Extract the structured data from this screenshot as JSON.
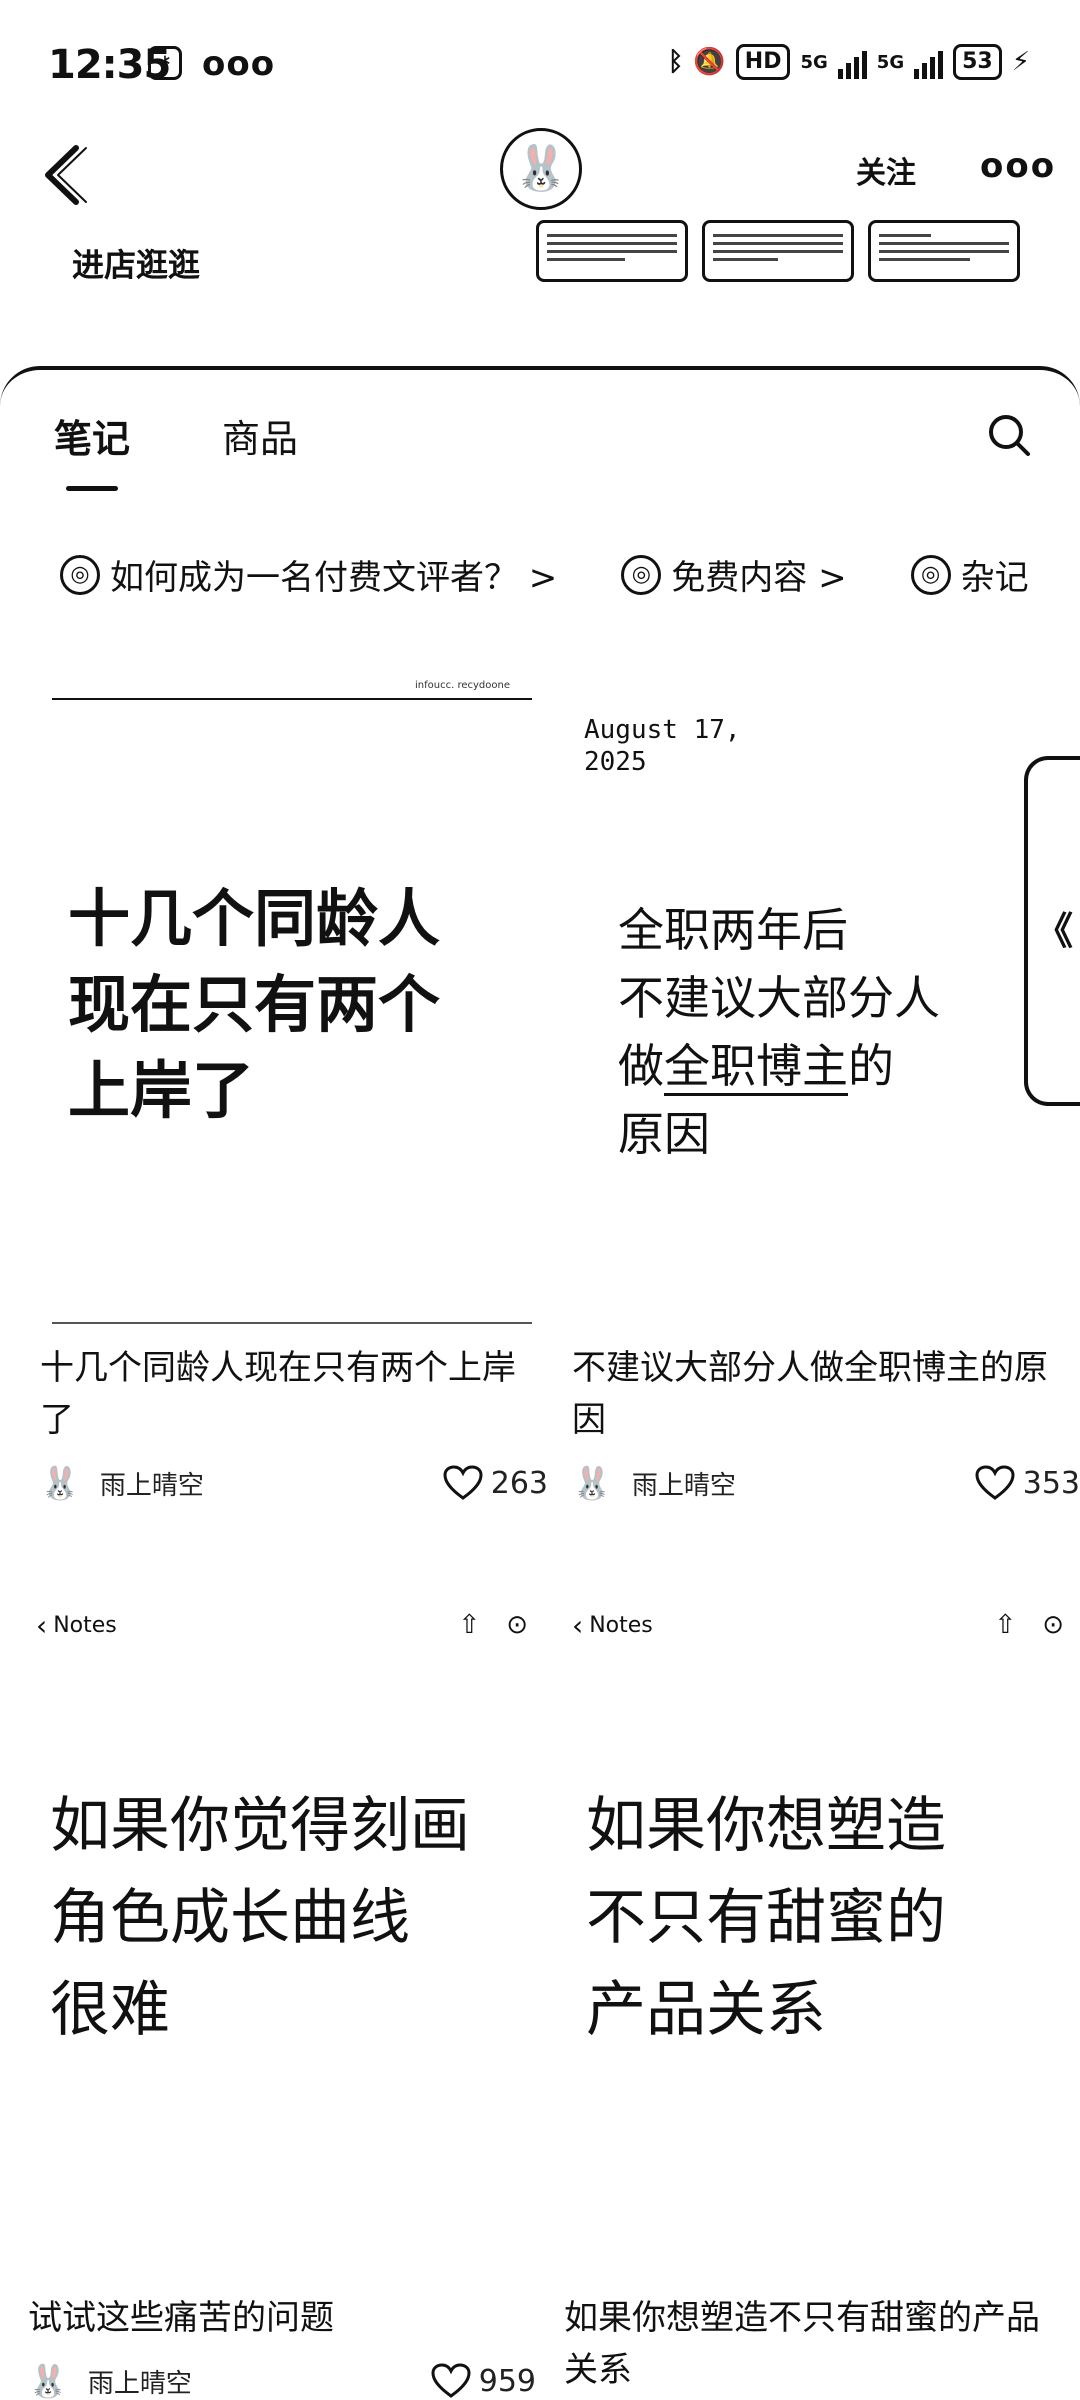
{
  "status": {
    "time": "12:35",
    "dots": "ooo",
    "hd": "HD",
    "net1": "5G",
    "net2": "5G",
    "battery": "53",
    "bolt": "⚡"
  },
  "header": {
    "follow_label": "关注",
    "more_label": "ooo",
    "shop_label": "进店逛逛",
    "avatar_glyph": "🐰"
  },
  "tabs": {
    "notes": "笔记",
    "goods": "商品"
  },
  "topics": [
    {
      "label": "如何成为一名付费文评者？ >"
    },
    {
      "label": "免费内容 >"
    },
    {
      "label": "杂记"
    }
  ],
  "cards": [
    {
      "cover_text": "十几个同龄人\n现在只有两个\n上岸了",
      "cover_source": "infoucc. recydoone",
      "title": "十几个同龄人现在只有两个上岸了",
      "author": "雨上晴空",
      "likes": "263"
    },
    {
      "cover_date": "August 17,\n2025",
      "cover_lines": [
        "全职两年后",
        "不建议大部分人",
        "做",
        "全职博主",
        "的",
        "原因"
      ],
      "title": "不建议大部分人做全职博主的原因",
      "author": "雨上晴空",
      "likes": "353"
    },
    {
      "notes_label": "Notes",
      "cover_text": "如果你觉得刻画\n角色成长曲线\n很难",
      "title": "试试这些痛苦的问题",
      "author": "雨上晴空",
      "likes": "959"
    },
    {
      "notes_label": "Notes",
      "cover_text": "如果你想塑造\n不只有甜蜜的\n产品关系",
      "title": "如果你想塑造不只有甜蜜的产品关系"
    }
  ],
  "side_tab": "《"
}
